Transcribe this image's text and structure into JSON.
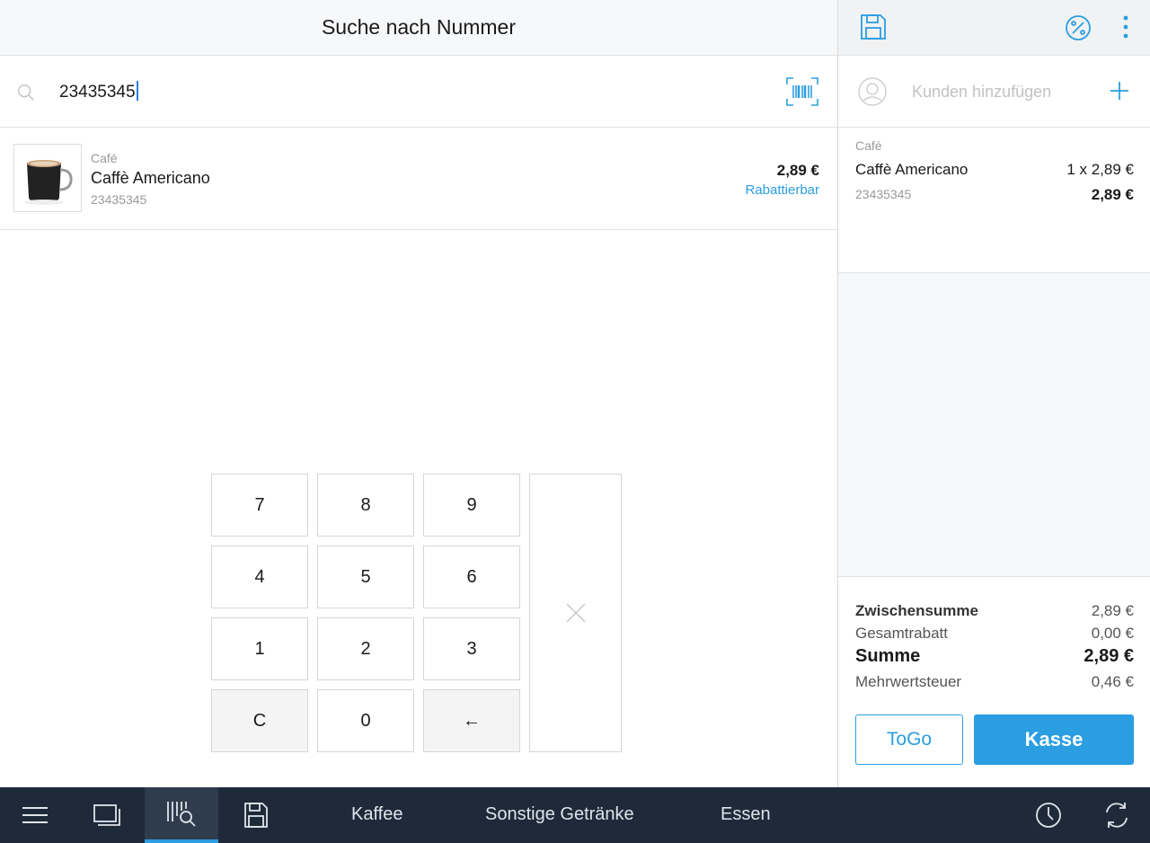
{
  "header": {
    "title": "Suche nach Nummer"
  },
  "search": {
    "value": "23435345",
    "icon": "search-icon",
    "scan_icon": "barcode-scan-icon"
  },
  "results": [
    {
      "category": "Café",
      "name": "Caffè Americano",
      "code": "23435345",
      "price": "2,89 €",
      "badge": "Rabattierbar"
    }
  ],
  "keypad": {
    "keys": [
      "7",
      "8",
      "9",
      "4",
      "5",
      "6",
      "1",
      "2",
      "3",
      "C",
      "0",
      "←"
    ],
    "enter_icon": "close-icon"
  },
  "cart_header": {
    "save_icon": "save-icon",
    "discount_icon": "percent-icon",
    "more_icon": "more-vertical-icon"
  },
  "customer": {
    "placeholder": "Kunden hinzufügen"
  },
  "cart": {
    "items": [
      {
        "category": "Café",
        "name": "Caffè Americano",
        "quantity": "1 x 2,89 €",
        "code": "23435345",
        "total": "2,89 €"
      }
    ]
  },
  "summary": {
    "subtotal_label": "Zwischensumme",
    "subtotal_value": "2,89 €",
    "discount_label": "Gesamtrabatt",
    "discount_value": "0,00 €",
    "sum_label": "Summe",
    "sum_value": "2,89 €",
    "tax_label": "Mehrwertsteuer",
    "tax_value": "0,46 €"
  },
  "actions": {
    "togo_label": "ToGo",
    "checkout_label": "Kasse"
  },
  "bottom_nav": {
    "categories": [
      "Kaffee",
      "Sonstige Getränke",
      "Essen"
    ],
    "icons": [
      "menu-icon",
      "product-grid-icon",
      "barcode-search-icon",
      "save-icon",
      "history-icon",
      "sync-icon"
    ]
  },
  "colors": {
    "accent": "#2a9ee0",
    "nav_bg": "#1e2a3a",
    "nav_active": "#2f3c4e"
  }
}
